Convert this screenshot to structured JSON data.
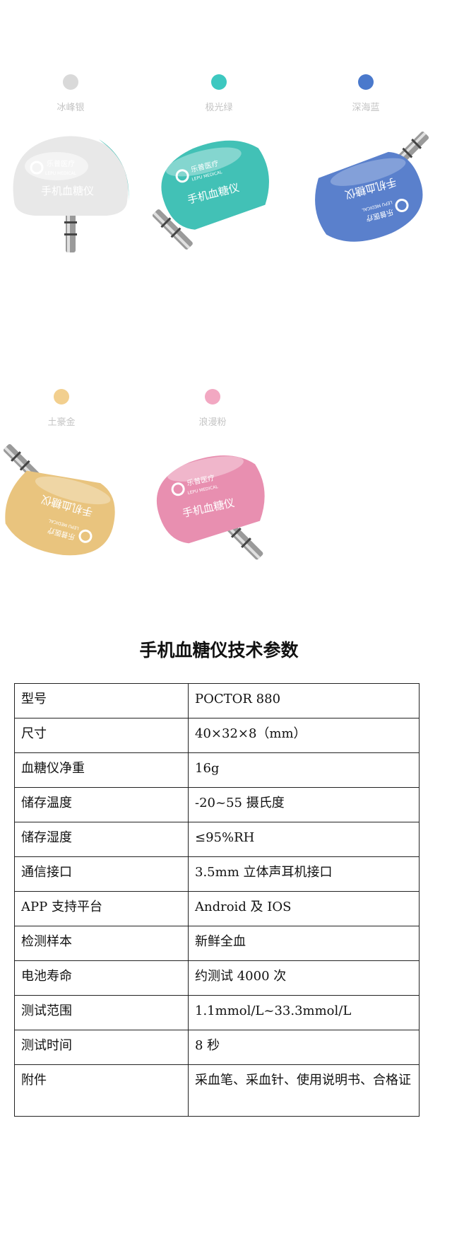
{
  "variants": [
    {
      "label": "冰峰银",
      "color": "#d9d9d9",
      "body_color": "#e8e8e8",
      "brand_cn": "乐普医疗",
      "brand_en": "LEPU MEDICAL",
      "product": "手机血糖仪"
    },
    {
      "label": "极光绿",
      "color": "#3dc8c0",
      "body_color": "#42c1b6",
      "brand_cn": "乐普医疗",
      "brand_en": "LEPU MEDICAL",
      "product": "手机血糖仪"
    },
    {
      "label": "深海蓝",
      "color": "#4a79cc",
      "body_color": "#5a80cc",
      "brand_cn": "乐普医疗",
      "brand_en": "LEPU MEDICAL",
      "product": "手机血糖仪"
    },
    {
      "label": "土豪金",
      "color": "#f2cf8e",
      "body_color": "#e9c47e",
      "brand_cn": "乐普医疗",
      "brand_en": "LEPU MEDICAL",
      "product": "手机血糖仪"
    },
    {
      "label": "浪漫粉",
      "color": "#f2a8c2",
      "body_color": "#e88fb0",
      "brand_cn": "乐普医疗",
      "brand_en": "LEPU MEDICAL",
      "product": "手机血糖仪"
    }
  ],
  "title": "手机血糖仪技术参数",
  "specs": [
    {
      "key": "型号",
      "value": "POCTOR 880"
    },
    {
      "key": "尺寸",
      "value": "40×32×8（mm）"
    },
    {
      "key": "血糖仪净重",
      "value": "16g"
    },
    {
      "key": "储存温度",
      "value": "-20~55 摄氏度"
    },
    {
      "key": "储存湿度",
      "value": "≤95%RH"
    },
    {
      "key": "通信接口",
      "value": "3.5mm 立体声耳机接口"
    },
    {
      "key": "APP 支持平台",
      "value": "Android 及 IOS"
    },
    {
      "key": "检测样本",
      "value": "新鲜全血"
    },
    {
      "key": "电池寿命",
      "value": "约测试 4000 次"
    },
    {
      "key": "测试范围",
      "value": "1.1mmol/L~33.3mmol/L"
    },
    {
      "key": "测试时间",
      "value": "8 秒"
    },
    {
      "key": "附件",
      "value": "采血笔、采血针、使用说明书、合格证"
    }
  ]
}
